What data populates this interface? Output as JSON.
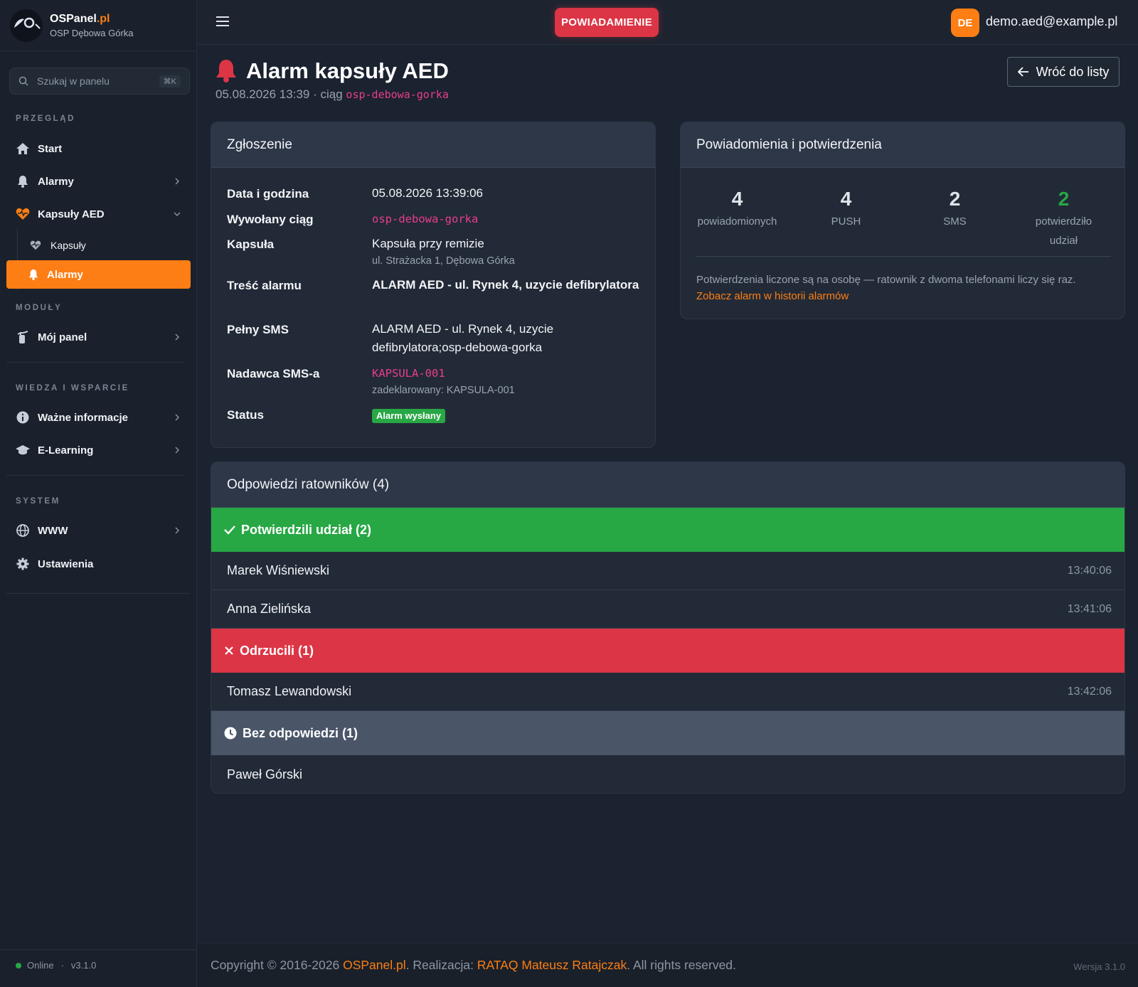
{
  "brand": {
    "name": "OSPanel",
    "tld": ".pl",
    "subtitle": "OSP Dębowa Górka",
    "logo_text": "O"
  },
  "search": {
    "placeholder": "Szukaj w panelu",
    "shortcut": "⌘K"
  },
  "sidebar": {
    "sections": {
      "overview": "PRZEGLĄD",
      "modules": "MODUŁY",
      "knowledge": "WIEDZA I WSPARCIE",
      "system": "SYSTEM"
    },
    "items": {
      "start": {
        "label": "Start",
        "icon": "home-icon"
      },
      "alarms": {
        "label": "Alarmy",
        "icon": "bell-icon"
      },
      "aed": {
        "label": "Kapsuły AED",
        "icon": "heart-pulse-icon"
      },
      "aed_capsules": {
        "label": "Kapsuły",
        "icon": "heart-pulse-icon"
      },
      "aed_alarms": {
        "label": "Alarmy",
        "icon": "bell-icon"
      },
      "my_panel": {
        "label": "Mój panel",
        "icon": "extinguisher-icon"
      },
      "info": {
        "label": "Ważne informacje",
        "icon": "info-icon"
      },
      "elearning": {
        "label": "E-Learning",
        "icon": "graduation-cap-icon"
      },
      "www": {
        "label": "WWW",
        "icon": "globe-icon"
      },
      "settings": {
        "label": "Ustawienia",
        "icon": "gear-icon"
      }
    },
    "footer": {
      "status": "Online",
      "sep": "·",
      "version": "v3.1.0"
    }
  },
  "topbar": {
    "notify_label": "POWIADAMIENIE",
    "user": {
      "initials": "DE",
      "email": "demo.aed@example.pl"
    }
  },
  "header": {
    "title": "Alarm kapsuły AED",
    "datetime": "05.08.2026 13:39",
    "sep": "·",
    "seq_prefix": "ciąg",
    "sequence": "osp-debowa-gorka",
    "back_label": "Wróć do listy"
  },
  "report": {
    "title": "Zgłoszenie",
    "rows": {
      "datetime": {
        "key": "Data i godzina",
        "value": "05.08.2026 13:39:06"
      },
      "sequence": {
        "key": "Wywołany ciąg",
        "value": "osp-debowa-gorka"
      },
      "capsule": {
        "key": "Kapsuła",
        "value": "Kapsuła przy remizie",
        "address": "ul. Strażacka 1, Dębowa Górka"
      },
      "content": {
        "key": "Treść alarmu",
        "value": "ALARM AED - ul. Rynek 4, uzycie defibrylatora"
      },
      "full_sms": {
        "key": "Pełny SMS",
        "value": "ALARM AED - ul. Rynek 4, uzycie defibrylatora;osp-debowa-gorka"
      },
      "sender": {
        "key": "Nadawca SMS-a",
        "value": "KAPSULA-001",
        "declared": "zadeklarowany: KAPSULA-001"
      },
      "status": {
        "key": "Status",
        "value": "Alarm wysłany",
        "color": "#28a745"
      }
    }
  },
  "notifications": {
    "title": "Powiadomienia i potwierdzenia",
    "stats": [
      {
        "value": "4",
        "label": "powiadomionych"
      },
      {
        "value": "4",
        "label": "PUSH"
      },
      {
        "value": "2",
        "label": "SMS"
      },
      {
        "value": "2",
        "label": "potwierdziło udział"
      }
    ],
    "note": "Potwierdzenia liczone są na osobę — ratownik z dwoma telefonami liczy się raz.",
    "history_link": "Zobacz alarm w historii alarmów"
  },
  "responses": {
    "title": "Odpowiedzi ratowników (4)",
    "confirmed": {
      "label": "Potwierdzili udział (2)",
      "color": "#28a745",
      "people": [
        {
          "name": "Marek Wiśniewski",
          "time": "13:40:06"
        },
        {
          "name": "Anna Zielińska",
          "time": "13:41:06"
        }
      ]
    },
    "rejected": {
      "label": "Odrzucili (1)",
      "color": "#dc3545",
      "people": [
        {
          "name": "Tomasz Lewandowski",
          "time": "13:42:06"
        }
      ]
    },
    "no_response": {
      "label": "Bez odpowiedzi (1)",
      "color": "#4a5568",
      "people": [
        {
          "name": "Paweł Górski",
          "time": ""
        }
      ]
    }
  },
  "footer": {
    "copy_prefix": "Copyright © 2016-2026",
    "brand": "OSPanel.pl",
    "realization_prefix": ". Realizacja:",
    "author": "RATAQ Mateusz Ratajczak",
    "rights": ". All rights reserved.",
    "version": "Wersja 3.1.0"
  },
  "colors": {
    "accent": "#fd7e14",
    "danger": "#dc3545",
    "success": "#28a745",
    "code": "#e83e8c"
  }
}
